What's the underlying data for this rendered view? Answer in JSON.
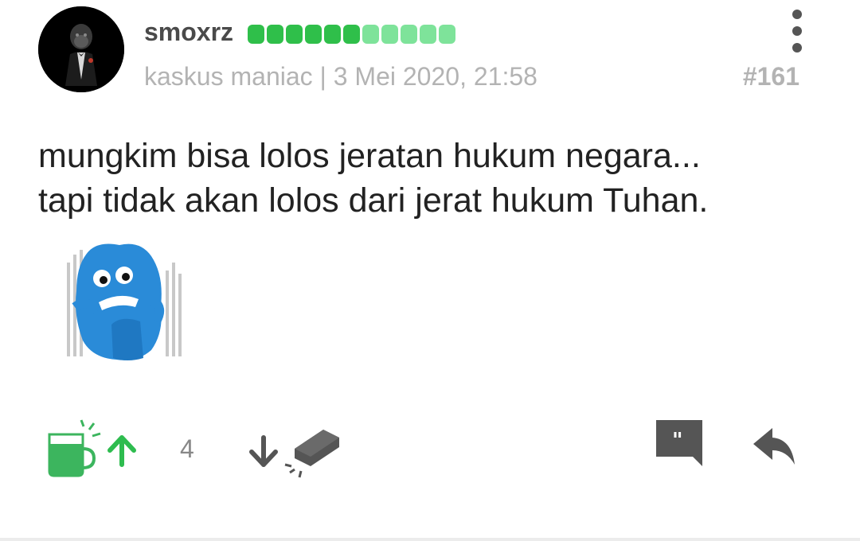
{
  "post": {
    "username": "smoxrz",
    "reputation": {
      "dark_dots": 6,
      "light_dots": 5,
      "dark_color": "#2fbf4a",
      "light_color": "#7ee39a"
    },
    "meta": "kaskus maniac | 3 Mei 2020, 21:58",
    "post_number": "#161",
    "content_lines": [
      "mungkim bisa lolos jeratan hukum negara...",
      "tapi tidak akan lolos dari jerat hukum Tuhan."
    ],
    "vote_count": "4"
  },
  "icons": {
    "avatar": "gorilla-suit-avatar",
    "more": "more-vertical-icon",
    "emoticon": "blue-monster-jail-emoticon",
    "cendol": "cendol-cup-icon",
    "upvote": "arrow-up-icon",
    "downvote": "arrow-down-icon",
    "bata": "brick-icon",
    "quote": "quote-bubble-icon",
    "reply": "reply-icon"
  },
  "colors": {
    "accent_green": "#3cb55e",
    "text_dark": "#222222",
    "text_muted": "#b3b3b3",
    "icon_dark": "#555555"
  }
}
